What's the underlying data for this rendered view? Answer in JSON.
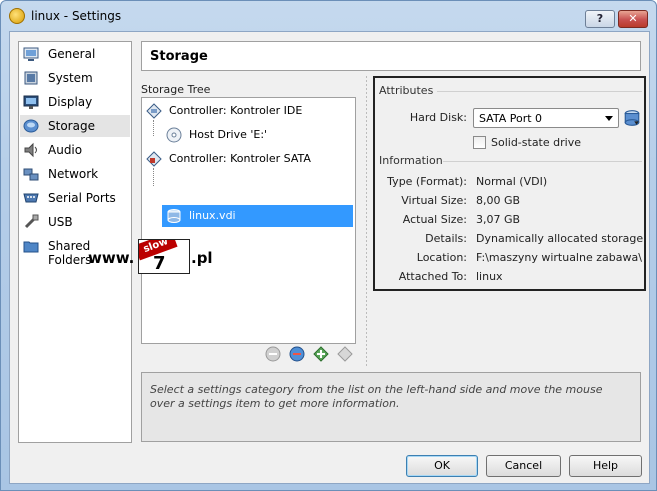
{
  "window": {
    "title": "linux - Settings",
    "help_label": "?",
    "close_label": "✕"
  },
  "sidebar": {
    "items": [
      {
        "label": "General",
        "icon": "general-icon"
      },
      {
        "label": "System",
        "icon": "system-icon"
      },
      {
        "label": "Display",
        "icon": "display-icon"
      },
      {
        "label": "Storage",
        "icon": "storage-icon",
        "selected": true
      },
      {
        "label": "Audio",
        "icon": "audio-icon"
      },
      {
        "label": "Network",
        "icon": "network-icon"
      },
      {
        "label": "Serial Ports",
        "icon": "serial-ports-icon"
      },
      {
        "label": "USB",
        "icon": "usb-icon"
      },
      {
        "label": "Shared Folders",
        "icon": "shared-folders-icon"
      }
    ]
  },
  "page_title": "Storage",
  "storage_tree": {
    "label": "Storage Tree",
    "items": [
      {
        "label": "Controller: Kontroler IDE"
      },
      {
        "label": "Host Drive 'E:'"
      },
      {
        "label": "Controller: Kontroler SATA"
      },
      {
        "label": "linux.vdi",
        "selected": true
      }
    ]
  },
  "attributes": {
    "title": "Attributes",
    "hard_disk_label": "Hard Disk:",
    "hard_disk_value": "SATA Port 0",
    "ssd_label": "Solid-state drive",
    "ssd_checked": false
  },
  "information": {
    "title": "Information",
    "rows": [
      {
        "label": "Type (Format):",
        "value": "Normal (VDI)"
      },
      {
        "label": "Virtual Size:",
        "value": "8,00 GB"
      },
      {
        "label": "Actual Size:",
        "value": "3,07 GB"
      },
      {
        "label": "Details:",
        "value": "Dynamically allocated storage"
      },
      {
        "label": "Location:",
        "value": "F:\\maszyny wirtualne zabawa\\lin..."
      },
      {
        "label": "Attached To:",
        "value": "linux"
      }
    ]
  },
  "help_text": "Select a settings category from the list on the left-hand side and move the mouse over a settings item to get more information.",
  "buttons": {
    "ok": "OK",
    "cancel": "Cancel",
    "help": "Help"
  },
  "watermark": {
    "prefix": "www.",
    "badge": "slow",
    "number": "7",
    "suffix": ".pl"
  },
  "colors": {
    "selection": "#3399ff",
    "accent_border": "#3c7fb1"
  }
}
